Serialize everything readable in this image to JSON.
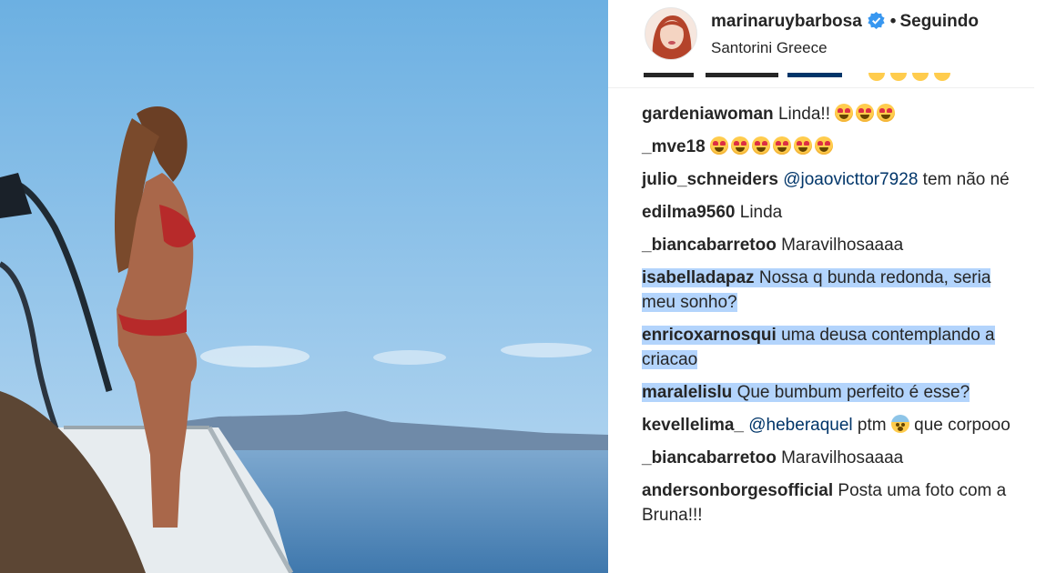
{
  "post": {
    "username": "marinaruybarbosa",
    "verified_icon": "verified-badge-icon",
    "separator": "•",
    "follow_status": "Seguindo",
    "location": "Santorini Greece"
  },
  "colors": {
    "sky_top": "#6fb2e3",
    "sky_bottom": "#c3def2",
    "sea": "#5f92bf",
    "mention": "#003569",
    "selection": "#b3d4fc",
    "verified": "#3897f0"
  },
  "comments": [
    {
      "user": "gardeniawoman",
      "text": "Linda!!",
      "emoji_count": 3,
      "selected": false
    },
    {
      "user": "_mve18",
      "text": "",
      "emoji_count": 6,
      "selected": false
    },
    {
      "user": "julio_schneiders",
      "mention": "@joaovicttor7928",
      "text": "tem não né",
      "selected": false
    },
    {
      "user": "edilma9560",
      "text": "Linda",
      "selected": false
    },
    {
      "user": "_biancabarretoo",
      "text": "Maravilhosaaaa",
      "selected": false
    },
    {
      "user": "isabelladapaz",
      "text": "Nossa q bunda redonda, seria meu sonho?",
      "selected": true
    },
    {
      "user": "enricoxarnosqui",
      "text": "uma deusa contemplando a criacao",
      "selected": true
    },
    {
      "user": "maralelislu",
      "text": "Que bumbum perfeito é esse?",
      "selected": true
    },
    {
      "user": "kevellelima_",
      "mention": "@heberaquel",
      "text": "ptm",
      "text2": "que corpooo",
      "fear_emoji": true,
      "selected": false
    },
    {
      "user": "_biancabarretoo",
      "text": "Maravilhosaaaa",
      "selected": false
    },
    {
      "user": "andersonborgesofficial",
      "text": "Posta uma foto com a Bruna!!!",
      "selected": false
    }
  ]
}
